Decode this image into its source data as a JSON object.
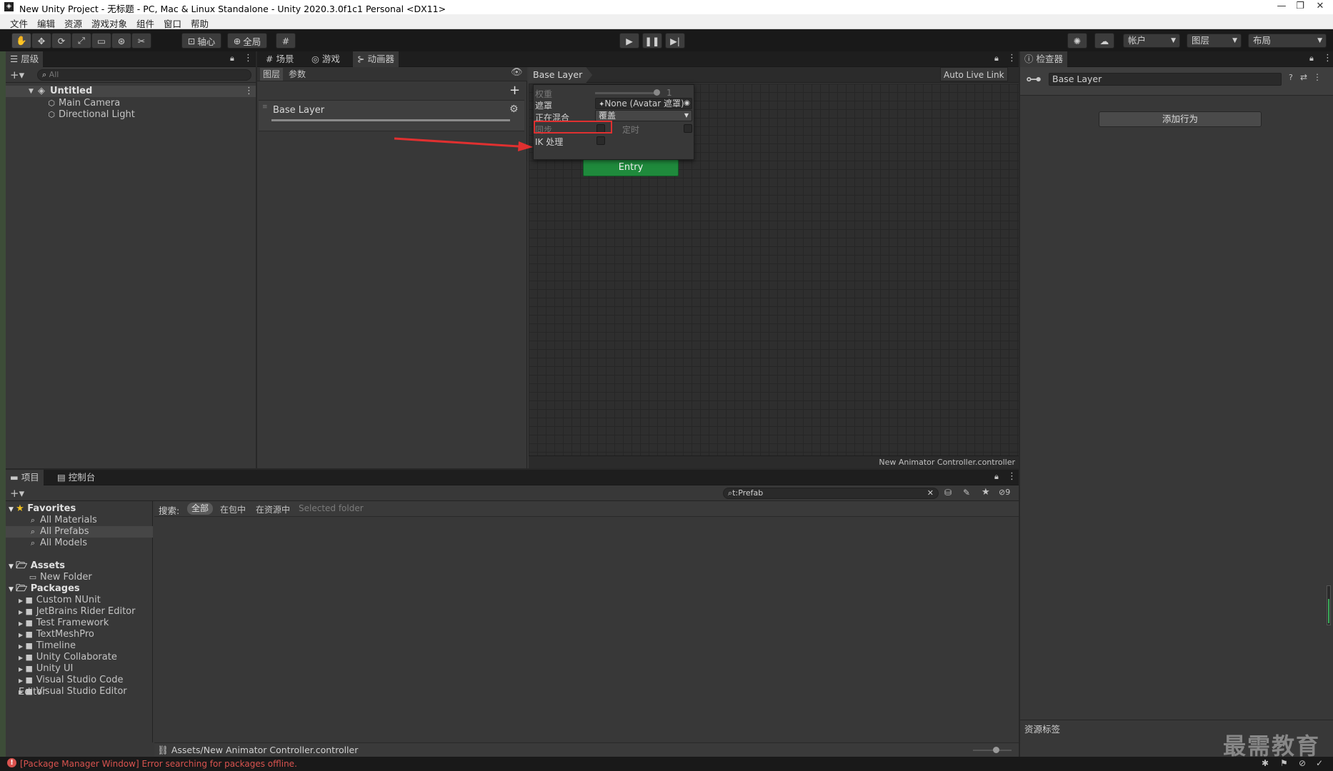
{
  "window": {
    "title": "New Unity Project - 无标题 - PC, Mac & Linux Standalone - Unity 2020.3.0f1c1 Personal <DX11>",
    "minimize": "—",
    "maximize": "❐",
    "close": "✕"
  },
  "menu": [
    "文件",
    "编辑",
    "资源",
    "游戏对象",
    "组件",
    "窗口",
    "帮助"
  ],
  "toolbar": {
    "pivot_label": "轴心",
    "global_label": "全局",
    "account_label": "帐户",
    "layers_label": "图层",
    "layout_label": "布局"
  },
  "hierarchy": {
    "tab_label": "层级",
    "search_placeholder": "All",
    "scene_name": "Untitled",
    "items": [
      "Main Camera",
      "Directional Light"
    ]
  },
  "center_tabs": [
    "场景",
    "游戏",
    "动画器"
  ],
  "animator": {
    "sub_tabs": [
      "图层",
      "参数"
    ],
    "layer_name": "Base Layer",
    "breadcrumb": "Base Layer",
    "auto_live_link": "Auto Live Link",
    "footer_file": "New Animator Controller.controller",
    "entry_label": "Entry",
    "settings": {
      "weight_label": "权重",
      "weight_value": "1",
      "mask_label": "遮罩",
      "mask_value": "None (Avatar 遮罩)",
      "blending_label": "正在混合",
      "blending_value": "覆盖",
      "sync_label": "同步",
      "timing_label": "定时",
      "ik_label": "IK 处理"
    }
  },
  "inspector": {
    "tab_label": "检查器",
    "name_value": "Base Layer",
    "add_behaviour_label": "添加行为",
    "asset_labels_title": "资源标签"
  },
  "project": {
    "tabs": [
      "项目",
      "控制台"
    ],
    "search_value": "t:Prefab",
    "hidden_count": "9",
    "search_label": "搜索:",
    "scope_options": [
      "全部",
      "在包中",
      "在资源中",
      "Selected folder"
    ],
    "favorites_label": "Favorites",
    "favorites": [
      "All Materials",
      "All Prefabs",
      "All Models"
    ],
    "assets_label": "Assets",
    "assets": [
      "New Folder"
    ],
    "packages_label": "Packages",
    "packages": [
      "Custom NUnit",
      "JetBrains Rider Editor",
      "Test Framework",
      "TextMeshPro",
      "Timeline",
      "Unity Collaborate",
      "Unity UI",
      "Visual Studio Code Editor",
      "Visual Studio Editor"
    ],
    "footer_path": "Assets/New Animator Controller.controller"
  },
  "status": {
    "error_text": "[Package Manager Window] Error searching for packages offline."
  },
  "watermark": "最需教育",
  "colors": {
    "accent_entry": "#1f8a3c",
    "annotation_red": "#e03030",
    "error_red": "#d9534f"
  }
}
